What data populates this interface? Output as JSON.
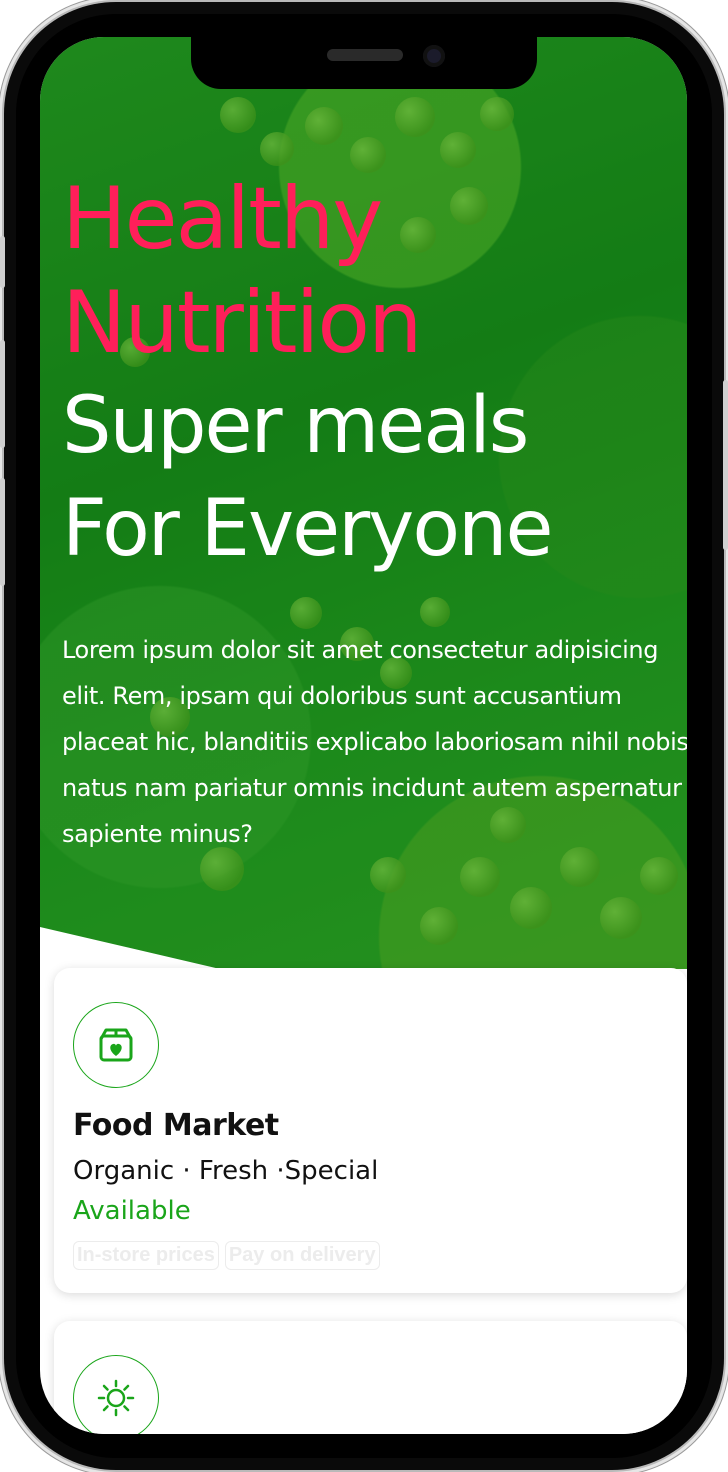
{
  "hero": {
    "title_line1": "Healthy",
    "title_line2": "Nutrition",
    "subtitle_line1": "Super meals",
    "subtitle_line2": "For Everyone",
    "description": "Lorem ipsum dolor sit amet consectetur adipisicing elit. Rem, ipsam qui doloribus sunt accusantium placeat hic, blanditiis explicabo laboriosam nihil nobis natus nam pariatur omnis incidunt autem aspernatur sapiente minus?"
  },
  "cards": [
    {
      "icon": "box-heart-icon",
      "title": "Food Market",
      "subtitle": "Organic · Fresh ·Special",
      "status": "Available",
      "tags": [
        "In-store prices",
        "Pay on delivery"
      ]
    },
    {
      "icon": "sun-icon"
    }
  ],
  "colors": {
    "accent_pink": "#ff1f5a",
    "accent_green": "#1aa51a",
    "hero_overlay": "#008000"
  }
}
